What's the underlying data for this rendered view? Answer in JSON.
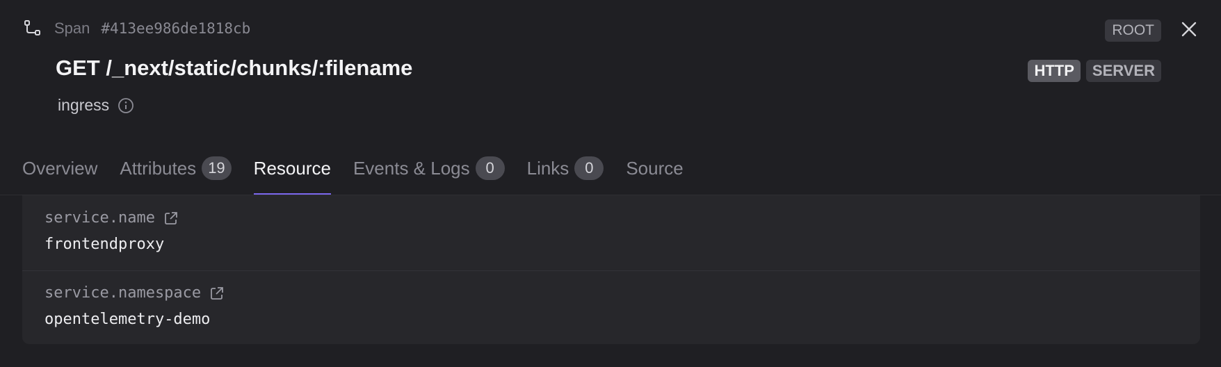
{
  "header": {
    "span_kind": "Span",
    "span_id": "#413ee986de1818cb",
    "root_badge": "ROOT",
    "title": "GET /_next/static/chunks/:filename",
    "tags": [
      "HTTP",
      "SERVER"
    ],
    "service": "ingress",
    "icons": {
      "span": "span-tree-icon",
      "close": "close-icon",
      "info": "info-icon"
    }
  },
  "tabs": [
    {
      "label": "Overview",
      "count": null,
      "active": false
    },
    {
      "label": "Attributes",
      "count": "19",
      "active": false
    },
    {
      "label": "Resource",
      "count": null,
      "active": true
    },
    {
      "label": "Events & Logs",
      "count": "0",
      "active": false
    },
    {
      "label": "Links",
      "count": "0",
      "active": false
    },
    {
      "label": "Source",
      "count": null,
      "active": false
    }
  ],
  "resource": {
    "attributes": [
      {
        "key": "service.name",
        "value": "frontendproxy"
      },
      {
        "key": "service.namespace",
        "value": "opentelemetry-demo"
      }
    ],
    "link_icon": "external-link-icon"
  },
  "colors": {
    "background": "#1f1f23",
    "accent": "#7b68ee"
  }
}
